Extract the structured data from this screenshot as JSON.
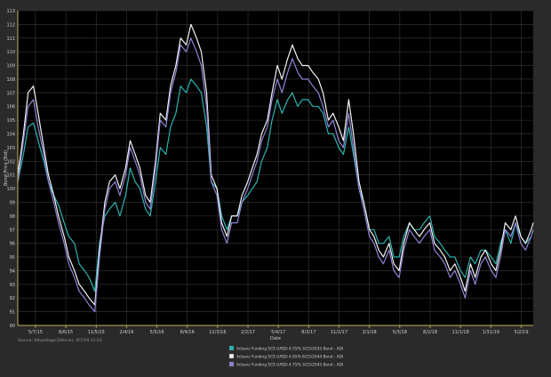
{
  "source_note": "Source: Advantage Data Inc. 6/7/19 11:23",
  "colors": {
    "background": "#2a2a2a",
    "plot_background": "#000000",
    "grid": "#3a3a3a",
    "axis": "#c8b25a",
    "text": "#cfcfcf"
  },
  "chart_data": {
    "type": "line",
    "title": "",
    "xlabel": "Date",
    "ylabel": "Bond Price (Bid)",
    "ylim": [
      90,
      113
    ],
    "yticks": [
      90,
      91,
      92,
      93,
      94,
      95,
      96,
      97,
      98,
      99,
      100,
      101,
      102,
      103,
      104,
      105,
      106,
      107,
      108,
      109,
      110,
      111,
      112,
      113
    ],
    "xticks": [
      {
        "label": "5/7/15",
        "date": "2015-05-07"
      },
      {
        "label": "8/6/15",
        "date": "2015-08-06"
      },
      {
        "label": "11/5/15",
        "date": "2015-11-05"
      },
      {
        "label": "2/4/16",
        "date": "2016-02-04"
      },
      {
        "label": "5/5/16",
        "date": "2016-05-05"
      },
      {
        "label": "8/4/16",
        "date": "2016-08-04"
      },
      {
        "label": "11/3/16",
        "date": "2016-11-03"
      },
      {
        "label": "2/2/17",
        "date": "2017-02-02"
      },
      {
        "label": "5/4/17",
        "date": "2017-05-04"
      },
      {
        "label": "8/3/17",
        "date": "2017-08-03"
      },
      {
        "label": "11/2/17",
        "date": "2017-11-02"
      },
      {
        "label": "2/1/18",
        "date": "2018-02-01"
      },
      {
        "label": "5/3/18",
        "date": "2018-05-03"
      },
      {
        "label": "8/2/18",
        "date": "2018-08-02"
      },
      {
        "label": "11/1/18",
        "date": "2018-11-01"
      },
      {
        "label": "1/31/19",
        "date": "2019-01-31"
      },
      {
        "label": "5/2/19",
        "date": "2019-05-02"
      }
    ],
    "xlim": [
      "2015-03-15",
      "2019-06-07"
    ],
    "grid": true,
    "legend_position": "bottom-center",
    "series": [
      {
        "name": "Actavis Funding SCS (USD) 4.55% 3/15/2035 Bond - ADI",
        "color": "#2ab5b0",
        "x": [
          "2015-03-15",
          "2015-04-01",
          "2015-04-15",
          "2015-05-01",
          "2015-05-15",
          "2015-06-01",
          "2015-06-15",
          "2015-07-01",
          "2015-07-15",
          "2015-08-01",
          "2015-08-15",
          "2015-09-01",
          "2015-09-15",
          "2015-10-01",
          "2015-10-15",
          "2015-11-01",
          "2015-11-15",
          "2015-12-01",
          "2015-12-15",
          "2016-01-01",
          "2016-01-15",
          "2016-02-01",
          "2016-02-15",
          "2016-03-01",
          "2016-03-15",
          "2016-04-01",
          "2016-04-15",
          "2016-05-01",
          "2016-05-15",
          "2016-06-01",
          "2016-06-15",
          "2016-07-01",
          "2016-07-15",
          "2016-08-01",
          "2016-08-15",
          "2016-09-01",
          "2016-09-15",
          "2016-10-01",
          "2016-10-15",
          "2016-11-01",
          "2016-11-15",
          "2016-12-01",
          "2016-12-15",
          "2017-01-01",
          "2017-01-15",
          "2017-02-01",
          "2017-02-15",
          "2017-03-01",
          "2017-03-15",
          "2017-04-01",
          "2017-04-15",
          "2017-05-01",
          "2017-05-15",
          "2017-06-01",
          "2017-06-15",
          "2017-07-01",
          "2017-07-15",
          "2017-08-01",
          "2017-08-15",
          "2017-09-01",
          "2017-09-15",
          "2017-10-01",
          "2017-10-15",
          "2017-11-01",
          "2017-11-15",
          "2017-12-01",
          "2017-12-15",
          "2018-01-01",
          "2018-01-15",
          "2018-02-01",
          "2018-02-15",
          "2018-03-01",
          "2018-03-15",
          "2018-04-01",
          "2018-04-15",
          "2018-05-01",
          "2018-05-15",
          "2018-06-01",
          "2018-06-15",
          "2018-07-01",
          "2018-07-15",
          "2018-08-01",
          "2018-08-15",
          "2018-09-01",
          "2018-09-15",
          "2018-10-01",
          "2018-10-15",
          "2018-11-01",
          "2018-11-15",
          "2018-12-01",
          "2018-12-15",
          "2019-01-01",
          "2019-01-15",
          "2019-02-01",
          "2019-02-15",
          "2019-03-01",
          "2019-03-15",
          "2019-04-01",
          "2019-04-15",
          "2019-05-01",
          "2019-05-15",
          "2019-06-01",
          "2019-06-07"
        ],
        "y": [
          100.5,
          102.5,
          104.5,
          104.8,
          103.5,
          102.0,
          100.5,
          99.5,
          98.8,
          97.5,
          96.5,
          96.0,
          94.5,
          94.0,
          93.5,
          92.5,
          96.0,
          98.0,
          98.5,
          99.0,
          98.0,
          99.5,
          101.5,
          100.5,
          100.0,
          98.5,
          98.0,
          100.5,
          103.0,
          102.5,
          104.5,
          105.5,
          107.5,
          107.0,
          108.0,
          107.5,
          107.0,
          104.5,
          100.5,
          100.0,
          98.0,
          97.0,
          98.0,
          98.0,
          99.0,
          99.5,
          100.0,
          100.5,
          102.0,
          103.0,
          105.0,
          106.5,
          105.5,
          106.5,
          107.0,
          106.0,
          106.5,
          106.5,
          106.0,
          106.0,
          105.5,
          104.0,
          104.0,
          103.0,
          102.5,
          104.5,
          102.5,
          100.0,
          99.0,
          97.0,
          97.0,
          96.0,
          96.0,
          96.5,
          95.0,
          95.0,
          96.5,
          97.5,
          97.0,
          97.0,
          97.5,
          98.0,
          96.5,
          96.0,
          95.5,
          95.0,
          95.0,
          94.0,
          93.5,
          95.0,
          94.5,
          95.5,
          95.5,
          95.0,
          94.5,
          96.0,
          97.0,
          96.0,
          97.5,
          96.5,
          96.0,
          96.5,
          97.0
        ]
      },
      {
        "name": "Actavis Funding SCS (USD) 4.85% 6/15/2044 Bond - ADI",
        "color": "#f2f2f2",
        "x": [
          "2015-03-15",
          "2015-04-01",
          "2015-04-15",
          "2015-05-01",
          "2015-05-15",
          "2015-06-01",
          "2015-06-15",
          "2015-07-01",
          "2015-07-15",
          "2015-08-01",
          "2015-08-15",
          "2015-09-01",
          "2015-09-15",
          "2015-10-01",
          "2015-10-15",
          "2015-11-01",
          "2015-11-15",
          "2015-12-01",
          "2015-12-15",
          "2016-01-01",
          "2016-01-15",
          "2016-02-01",
          "2016-02-15",
          "2016-03-01",
          "2016-03-15",
          "2016-04-01",
          "2016-04-15",
          "2016-05-01",
          "2016-05-15",
          "2016-06-01",
          "2016-06-15",
          "2016-07-01",
          "2016-07-15",
          "2016-08-01",
          "2016-08-15",
          "2016-09-01",
          "2016-09-15",
          "2016-10-01",
          "2016-10-15",
          "2016-11-01",
          "2016-11-15",
          "2016-12-01",
          "2016-12-15",
          "2017-01-01",
          "2017-01-15",
          "2017-02-01",
          "2017-02-15",
          "2017-03-01",
          "2017-03-15",
          "2017-04-01",
          "2017-04-15",
          "2017-05-01",
          "2017-05-15",
          "2017-06-01",
          "2017-06-15",
          "2017-07-01",
          "2017-07-15",
          "2017-08-01",
          "2017-08-15",
          "2017-09-01",
          "2017-09-15",
          "2017-10-01",
          "2017-10-15",
          "2017-11-01",
          "2017-11-15",
          "2017-12-01",
          "2017-12-15",
          "2018-01-01",
          "2018-01-15",
          "2018-02-01",
          "2018-02-15",
          "2018-03-01",
          "2018-03-15",
          "2018-04-01",
          "2018-04-15",
          "2018-05-01",
          "2018-05-15",
          "2018-06-01",
          "2018-06-15",
          "2018-07-01",
          "2018-07-15",
          "2018-08-01",
          "2018-08-15",
          "2018-09-01",
          "2018-09-15",
          "2018-10-01",
          "2018-10-15",
          "2018-11-01",
          "2018-11-15",
          "2018-12-01",
          "2018-12-15",
          "2019-01-01",
          "2019-01-15",
          "2019-02-01",
          "2019-02-15",
          "2019-03-01",
          "2019-03-15",
          "2019-04-01",
          "2019-04-15",
          "2019-05-01",
          "2019-05-15",
          "2019-06-01",
          "2019-06-07"
        ],
        "y": [
          101.0,
          104.0,
          107.0,
          107.5,
          105.5,
          103.0,
          101.0,
          99.5,
          98.0,
          96.5,
          95.0,
          94.0,
          93.0,
          92.5,
          92.0,
          91.5,
          95.5,
          99.0,
          100.5,
          101.0,
          100.0,
          101.5,
          103.5,
          102.5,
          101.5,
          99.5,
          99.0,
          102.0,
          105.5,
          105.0,
          107.5,
          109.0,
          111.0,
          110.5,
          112.0,
          111.0,
          110.0,
          107.0,
          101.0,
          100.0,
          97.5,
          96.5,
          98.0,
          98.0,
          99.5,
          100.5,
          101.5,
          102.5,
          104.0,
          105.0,
          107.0,
          109.0,
          108.0,
          109.5,
          110.5,
          109.5,
          109.0,
          109.0,
          108.5,
          108.0,
          107.0,
          105.0,
          105.5,
          104.5,
          103.5,
          106.5,
          104.0,
          100.5,
          99.0,
          97.0,
          96.5,
          95.5,
          95.0,
          96.0,
          94.5,
          94.0,
          96.0,
          97.5,
          97.0,
          96.5,
          97.0,
          97.5,
          96.0,
          95.5,
          95.0,
          94.0,
          94.5,
          93.5,
          92.5,
          94.5,
          93.5,
          95.0,
          95.5,
          94.5,
          94.0,
          95.5,
          97.5,
          97.0,
          98.0,
          96.5,
          96.0,
          97.0,
          97.5
        ]
      },
      {
        "name": "Actavis Funding SCS (USD) 4.75% 3/15/2045 Bond - ADI",
        "color": "#8f84d6",
        "x": [
          "2015-03-15",
          "2015-04-01",
          "2015-04-15",
          "2015-05-01",
          "2015-05-15",
          "2015-06-01",
          "2015-06-15",
          "2015-07-01",
          "2015-07-15",
          "2015-08-01",
          "2015-08-15",
          "2015-09-01",
          "2015-09-15",
          "2015-10-01",
          "2015-10-15",
          "2015-11-01",
          "2015-11-15",
          "2015-12-01",
          "2015-12-15",
          "2016-01-01",
          "2016-01-15",
          "2016-02-01",
          "2016-02-15",
          "2016-03-01",
          "2016-03-15",
          "2016-04-01",
          "2016-04-15",
          "2016-05-01",
          "2016-05-15",
          "2016-06-01",
          "2016-06-15",
          "2016-07-01",
          "2016-07-15",
          "2016-08-01",
          "2016-08-15",
          "2016-09-01",
          "2016-09-15",
          "2016-10-01",
          "2016-10-15",
          "2016-11-01",
          "2016-11-15",
          "2016-12-01",
          "2016-12-15",
          "2017-01-01",
          "2017-01-15",
          "2017-02-01",
          "2017-02-15",
          "2017-03-01",
          "2017-03-15",
          "2017-04-01",
          "2017-04-15",
          "2017-05-01",
          "2017-05-15",
          "2017-06-01",
          "2017-06-15",
          "2017-07-01",
          "2017-07-15",
          "2017-08-01",
          "2017-08-15",
          "2017-09-01",
          "2017-09-15",
          "2017-10-01",
          "2017-10-15",
          "2017-11-01",
          "2017-11-15",
          "2017-12-01",
          "2017-12-15",
          "2018-01-01",
          "2018-01-15",
          "2018-02-01",
          "2018-02-15",
          "2018-03-01",
          "2018-03-15",
          "2018-04-01",
          "2018-04-15",
          "2018-05-01",
          "2018-05-15",
          "2018-06-01",
          "2018-06-15",
          "2018-07-01",
          "2018-07-15",
          "2018-08-01",
          "2018-08-15",
          "2018-09-01",
          "2018-09-15",
          "2018-10-01",
          "2018-10-15",
          "2018-11-01",
          "2018-11-15",
          "2018-12-01",
          "2018-12-15",
          "2019-01-01",
          "2019-01-15",
          "2019-02-01",
          "2019-02-15",
          "2019-03-01",
          "2019-03-15",
          "2019-04-01",
          "2019-04-15",
          "2019-05-01",
          "2019-05-15",
          "2019-06-01",
          "2019-06-07"
        ],
        "y": [
          100.5,
          103.5,
          106.0,
          106.5,
          104.5,
          102.5,
          100.5,
          99.0,
          97.5,
          96.0,
          94.5,
          93.5,
          92.5,
          92.0,
          91.5,
          91.0,
          95.0,
          98.5,
          100.0,
          100.5,
          99.5,
          101.0,
          103.0,
          102.0,
          101.0,
          99.0,
          98.5,
          101.5,
          105.0,
          104.5,
          107.0,
          108.5,
          110.5,
          110.0,
          111.0,
          110.0,
          109.0,
          106.0,
          100.5,
          99.5,
          97.0,
          96.0,
          97.5,
          97.5,
          99.0,
          100.0,
          101.0,
          102.0,
          103.5,
          104.5,
          106.5,
          108.0,
          107.0,
          108.5,
          109.5,
          108.5,
          108.0,
          108.0,
          107.5,
          107.0,
          106.0,
          104.5,
          105.0,
          103.5,
          103.0,
          105.5,
          103.0,
          100.0,
          98.5,
          96.5,
          96.0,
          95.0,
          94.5,
          95.5,
          94.0,
          93.5,
          95.5,
          97.0,
          96.5,
          96.0,
          96.5,
          97.0,
          95.5,
          95.0,
          94.5,
          93.5,
          94.0,
          93.0,
          92.0,
          94.0,
          93.0,
          94.5,
          95.0,
          94.0,
          93.5,
          95.0,
          97.0,
          96.5,
          97.5,
          96.0,
          95.5,
          96.5,
          97.0
        ]
      }
    ]
  }
}
